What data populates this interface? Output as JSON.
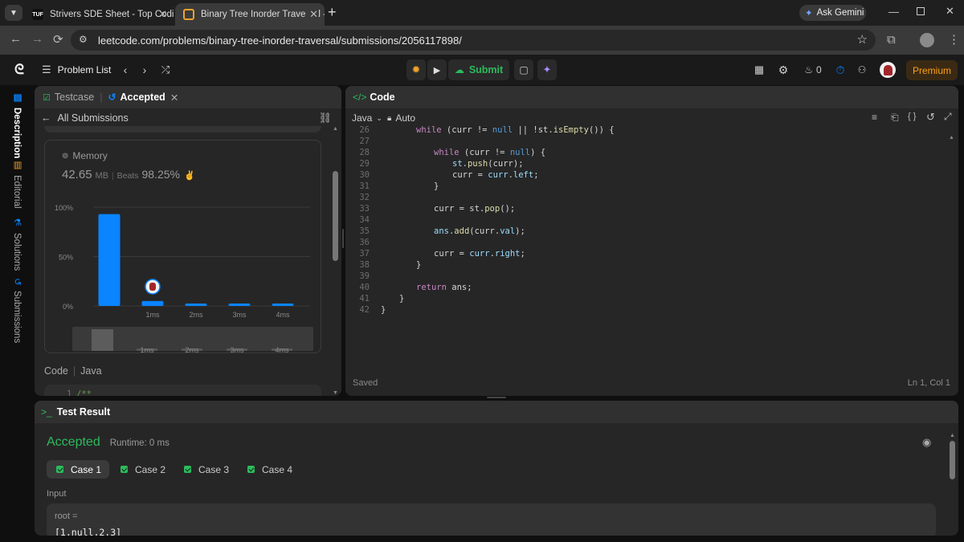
{
  "browser": {
    "tabs": [
      {
        "title": "Strivers SDE Sheet - Top Coding"
      },
      {
        "title": "Binary Tree Inorder Traversal - L"
      }
    ],
    "ask_gemini": "Ask Gemini",
    "url": "leetcode.com/problems/binary-tree-inorder-traversal/submissions/2056117898/"
  },
  "nav": {
    "problem_list": "Problem List",
    "submit": "Submit",
    "streak_count": "0",
    "premium": "Premium"
  },
  "sidebar": {
    "items": [
      {
        "label": "Description"
      },
      {
        "label": "Editorial"
      },
      {
        "label": "Solutions"
      },
      {
        "label": "Submissions"
      }
    ]
  },
  "submission": {
    "tab_testcase": "Testcase",
    "tab_accepted": "Accepted",
    "back_label": "All Submissions",
    "memory_label": "Memory",
    "memory_value": "42.65",
    "memory_unit": "MB",
    "beats_label": "Beats",
    "beats_value": "98.25%",
    "code_label": "Code",
    "code_lang": "Java",
    "code_preview_line": "1",
    "code_preview_text": "/**"
  },
  "chart_data": {
    "type": "bar",
    "categories": [
      "",
      "1ms",
      "2ms",
      "3ms",
      "4ms"
    ],
    "values": [
      93,
      5,
      2,
      2,
      2
    ],
    "ylim": [
      0,
      100
    ],
    "yticks": [
      "0%",
      "50%",
      "100%"
    ],
    "minimap_ticks": [
      "1ms",
      "2ms",
      "3ms",
      "4ms"
    ],
    "colors": {
      "bar": "#0a84ff",
      "grid": "#3a3a3a"
    }
  },
  "editor": {
    "title": "Code",
    "language": "Java",
    "mode": "Auto",
    "status_saved": "Saved",
    "cursor_pos": "Ln 1, Col 1",
    "lines": [
      {
        "n": "26"
      },
      {
        "n": "27"
      },
      {
        "n": "28"
      },
      {
        "n": "29"
      },
      {
        "n": "30"
      },
      {
        "n": "31"
      },
      {
        "n": "32"
      },
      {
        "n": "33"
      },
      {
        "n": "34"
      },
      {
        "n": "35"
      },
      {
        "n": "36"
      },
      {
        "n": "37"
      },
      {
        "n": "38"
      },
      {
        "n": "39"
      },
      {
        "n": "40"
      },
      {
        "n": "41"
      },
      {
        "n": "42"
      }
    ],
    "code": {
      "l26a": "while",
      "l26b": " (curr != ",
      "l26c": "null",
      "l26d": " || !st.",
      "l26e": "isEmpty",
      "l26f": "()) {",
      "l28a": "while",
      "l28b": " (curr != ",
      "l28c": "null",
      "l28d": ") {",
      "l29a": "st.",
      "l29b": "push",
      "l29c": "(curr);",
      "l30a": "curr = ",
      "l30b": "curr",
      "l30c": ".",
      "l30d": "left",
      "l30e": ";",
      "l31": "}",
      "l33a": "curr = st.",
      "l33b": "pop",
      "l33c": "();",
      "l35a": "ans.",
      "l35b": "add",
      "l35c": "(curr.",
      "l35d": "val",
      "l35e": ");",
      "l37a": "curr = ",
      "l37b": "curr",
      "l37c": ".",
      "l37d": "right",
      "l37e": ";",
      "l38": "}",
      "l40a": "return",
      "l40b": " ans;",
      "l41": "}",
      "l42": "}"
    }
  },
  "result": {
    "title": "Test Result",
    "status": "Accepted",
    "runtime": "Runtime: 0 ms",
    "cases": [
      {
        "label": "Case 1"
      },
      {
        "label": "Case 2"
      },
      {
        "label": "Case 3"
      },
      {
        "label": "Case 4"
      }
    ],
    "input_label": "Input",
    "param_name": "root =",
    "param_value": "[1,null,2,3]"
  }
}
